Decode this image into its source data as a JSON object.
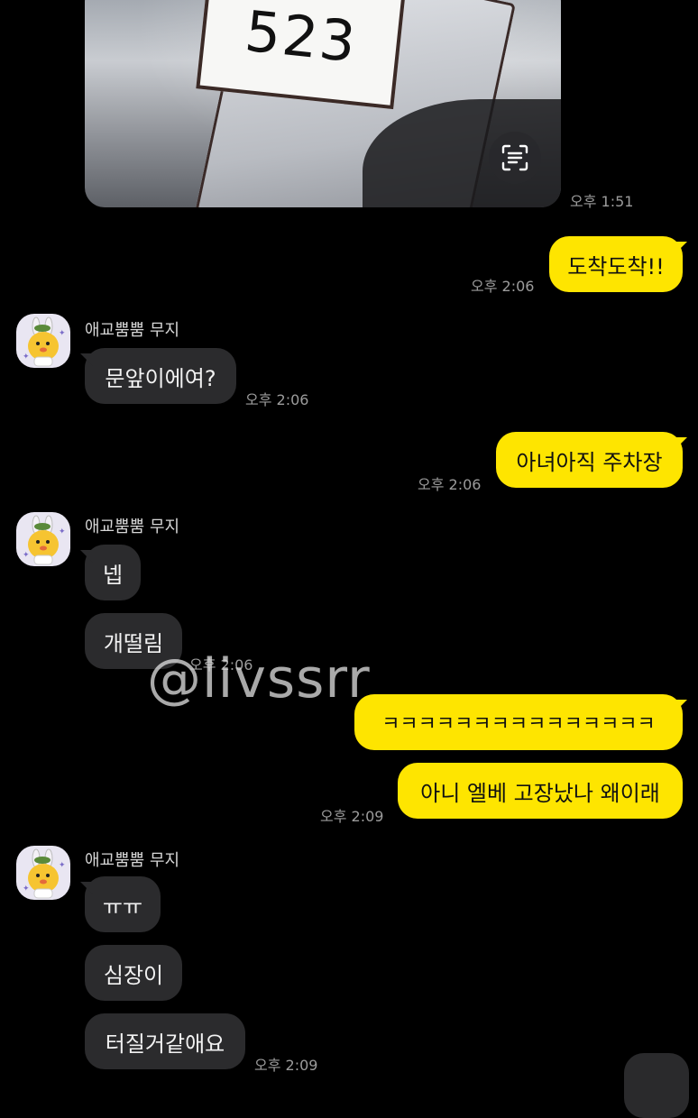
{
  "photo_message": {
    "number_label": "523",
    "time": "오후 1:51",
    "scan_icon": "text-scan-icon"
  },
  "messages": [
    {
      "id": "m1",
      "from": "me",
      "text": "도착도착!!",
      "time": "오후 2:06"
    },
    {
      "id": "m2",
      "from": "them",
      "sender": "애교뿜뿜 무지",
      "text": "문앞이에여?",
      "time": "오후 2:06"
    },
    {
      "id": "m3",
      "from": "me",
      "text": "아녀아직 주차장",
      "time": "오후 2:06"
    },
    {
      "id": "m4",
      "from": "them",
      "sender": "애교뿜뿜 무지",
      "texts": [
        "넵",
        "개떨림"
      ],
      "time": "오후 2:06"
    },
    {
      "id": "m5",
      "from": "me",
      "texts": [
        "ㅋㅋㅋㅋㅋㅋㅋㅋㅋㅋㅋㅋㅋㅋㅋ",
        "아니 엘베 고장났나 왜이래"
      ],
      "time": "오후 2:09"
    },
    {
      "id": "m6",
      "from": "them",
      "sender": "애교뿜뿜 무지",
      "texts": [
        "ㅠㅠ",
        "심장이",
        "터질거같애요"
      ],
      "time": "오후 2:09"
    }
  ],
  "watermark": "@livssrr",
  "colors": {
    "background": "#000000",
    "my_bubble": "#fee500",
    "their_bubble": "#2b2b2d",
    "timestamp": "#9c9c9c"
  }
}
